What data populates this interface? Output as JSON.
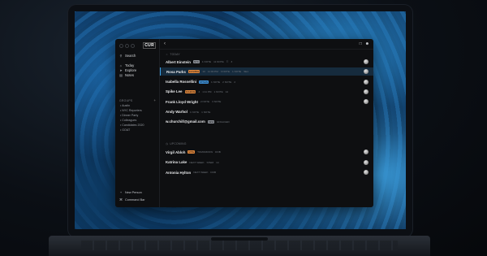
{
  "app": {
    "brand": "CUR",
    "sidebar": {
      "search": "Search",
      "nav": [
        {
          "label": "Today",
          "icon": "sun-icon"
        },
        {
          "label": "Explore",
          "icon": "compass-icon"
        },
        {
          "label": "Notes",
          "icon": "note-icon"
        }
      ],
      "groups_header": "GROUPS",
      "groups_plus": "+",
      "groups": [
        "Austin",
        "NYC Reporters",
        "Dinner Party",
        "Colleagues",
        "Candidates 2020",
        "GOAT"
      ],
      "bottom": [
        {
          "label": "New Person",
          "icon": "plus-icon"
        },
        {
          "label": "Command Bar",
          "icon": "command-icon"
        }
      ]
    },
    "sections": {
      "today": "TODAY",
      "upcoming": "UPCOMING"
    },
    "colors": {
      "accent": "#3aa0e6",
      "pill_orange": "#e0873c",
      "pill_blue": "#3d8fd6",
      "pill_grey": "#8a8e95"
    },
    "today_rows": [
      {
        "name": "Albert Einstein",
        "pill": "NYC",
        "pill_color": "grey",
        "meta": [
          "1 NOTE",
          "11 NOTE",
          "☷",
          "3"
        ],
        "avatar": true
      },
      {
        "name": "Rosa Parks",
        "pill": "ELIGIBLE",
        "pill_color": "orange",
        "meta": [
          "10",
          "11:00 PM",
          "3 NOTE",
          "1 NOTE",
          "SE1"
        ],
        "avatar": true,
        "selected": true
      },
      {
        "name": "Isabella Rossellini",
        "pill": "STIVAN",
        "pill_color": "blue",
        "meta": [
          "1 NOTE",
          "2 NOTE",
          "2"
        ],
        "avatar": true
      },
      {
        "name": "Spike Lee",
        "pill": "SCHEME",
        "pill_color": "orange",
        "meta": [
          "4",
          "1:11 PM",
          "1 NOTE",
          "14"
        ],
        "avatar": true
      },
      {
        "name": "Frank Lloyd Wright",
        "pill": "",
        "pill_color": "grey",
        "meta": [
          "2 NOTE",
          "3 NOTE"
        ],
        "avatar": true
      },
      {
        "name": "Andy Warhol",
        "pill": "",
        "pill_color": "grey",
        "meta": [
          "1 NOTE",
          "1 NOTE"
        ],
        "avatar": false
      },
      {
        "name": "w.churchill@gmail.com",
        "pill": "NEW",
        "pill_color": "grey",
        "meta": [
          "ENGAGED"
        ],
        "avatar": false
      }
    ],
    "upcoming_rows": [
      {
        "name": "Virgil Abloh",
        "pill": "MITE",
        "pill_color": "orange",
        "meta": [
          "TOMORROW",
          "DOB"
        ],
        "avatar": true
      },
      {
        "name": "Katrina Lake",
        "pill": "",
        "pill_color": "grey",
        "meta": [
          "NEXT WEEK",
          "STEM",
          "14"
        ],
        "avatar": true
      },
      {
        "name": "Antonia Hylton",
        "pill": "",
        "pill_color": "grey",
        "meta": [
          "NEXT WEEK",
          "DOB"
        ],
        "avatar": true
      }
    ]
  }
}
